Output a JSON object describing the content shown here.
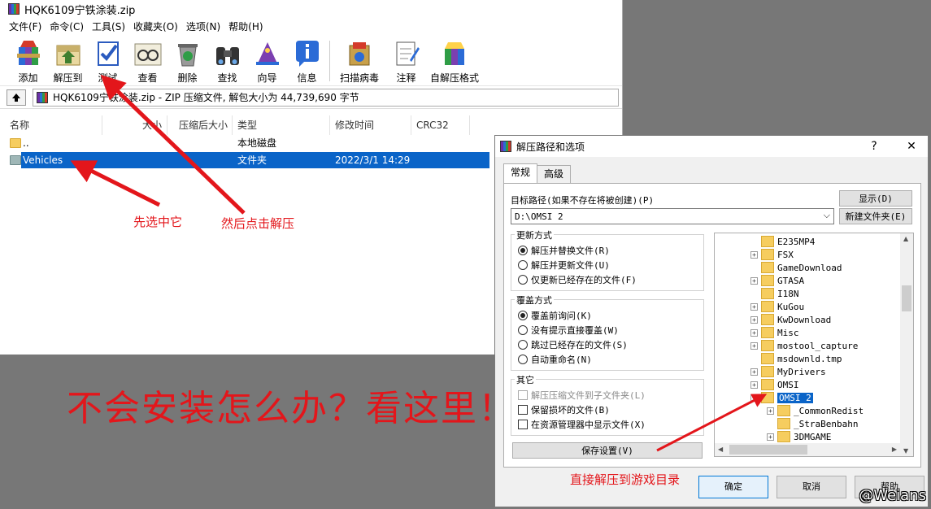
{
  "window": {
    "title": "HQK6109宁铁涂装.zip"
  },
  "menu": [
    "文件(F)",
    "命令(C)",
    "工具(S)",
    "收藏夹(O)",
    "选项(N)",
    "帮助(H)"
  ],
  "toolbar": {
    "add": "添加",
    "extract_to": "解压到",
    "test": "测试",
    "view": "查看",
    "delete": "删除",
    "find": "查找",
    "wizard": "向导",
    "info": "信息",
    "virus_scan": "扫描病毒",
    "comment": "注释",
    "sfx": "自解压格式"
  },
  "address": {
    "text": "HQK6109宁铁涂装.zip - ZIP 压缩文件, 解包大小为 44,739,690 字节"
  },
  "columns": {
    "name": "名称",
    "size": "大小",
    "packed": "压缩后大小",
    "type": "类型",
    "modified": "修改时间",
    "crc": "CRC32"
  },
  "files": [
    {
      "name": "..",
      "size": "",
      "type": "本地磁盘",
      "modified": ""
    },
    {
      "name": "Vehicles",
      "size": "",
      "type": "文件夹",
      "modified": "2022/3/1 14:29"
    }
  ],
  "annotations": {
    "select_first": "先选中它",
    "then_extract": "然后点击解压",
    "help_banner": "不会安装怎么办？看这里！",
    "extract_to_game": "直接解压到游戏目录"
  },
  "dialog": {
    "title": "解压路径和选项",
    "help_btn": "?",
    "close_btn": "✕",
    "tab_general": "常规",
    "tab_advanced": "高级",
    "dest_label": "目标路径(如果不存在将被创建)(P)",
    "dest_value": "D:\\OMSI 2",
    "show_btn": "显示(D)",
    "new_folder_btn": "新建文件夹(E)",
    "update_group": "更新方式",
    "update_options": [
      "解压并替换文件(R)",
      "解压并更新文件(U)",
      "仅更新已经存在的文件(F)"
    ],
    "overwrite_group": "覆盖方式",
    "overwrite_options": [
      "覆盖前询问(K)",
      "没有提示直接覆盖(W)",
      "跳过已经存在的文件(S)",
      "自动重命名(N)"
    ],
    "misc_group": "其它",
    "misc_options": [
      "解压压缩文件到子文件夹(L)",
      "保留损坏的文件(B)",
      "在资源管理器中显示文件(X)"
    ],
    "save_settings_btn": "保存设置(V)",
    "ok_btn": "确定",
    "cancel_btn": "取消",
    "help_button": "帮助",
    "tree": [
      {
        "label": "E235MP4",
        "expand": false
      },
      {
        "label": "FSX",
        "expand": true
      },
      {
        "label": "GameDownload",
        "expand": false
      },
      {
        "label": "GTASA",
        "expand": true
      },
      {
        "label": "I18N",
        "expand": false
      },
      {
        "label": "KuGou",
        "expand": true
      },
      {
        "label": "KwDownload",
        "expand": true
      },
      {
        "label": "Misc",
        "expand": true
      },
      {
        "label": "mostool_capture",
        "expand": true
      },
      {
        "label": "msdownld.tmp",
        "expand": false
      },
      {
        "label": "MyDrivers",
        "expand": true
      },
      {
        "label": "OMSI",
        "expand": true
      },
      {
        "label": "OMSI 2",
        "expand": true
      },
      {
        "label": "_CommonRedist",
        "expand": true
      },
      {
        "label": "_StraBenbahn",
        "expand": false
      },
      {
        "label": "3DMGAME",
        "expand": true
      }
    ]
  },
  "watermark": "@Weians",
  "colors": {
    "annotation_red": "#e3161b",
    "selection_blue": "#0a64c8"
  }
}
